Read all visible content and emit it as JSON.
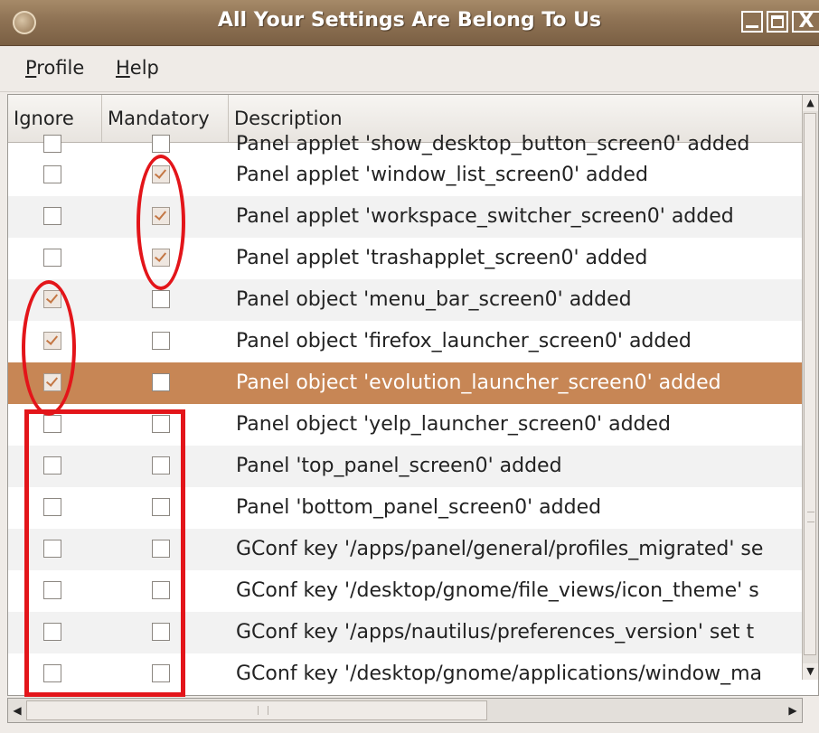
{
  "window": {
    "title": "All Your Settings Are Belong To Us",
    "close_glyph": "X"
  },
  "menubar": {
    "items": [
      {
        "label": "rofile",
        "mnemonic": "P"
      },
      {
        "label": "elp",
        "mnemonic": "H"
      }
    ]
  },
  "table": {
    "columns": [
      "Ignore",
      "Mandatory",
      "Description"
    ],
    "partial_row_text": "Panel applet 'show_desktop_button_screen0' added",
    "rows": [
      {
        "ignore": false,
        "mandatory": true,
        "description": "Panel applet 'window_list_screen0' added"
      },
      {
        "ignore": false,
        "mandatory": true,
        "description": "Panel applet 'workspace_switcher_screen0' added"
      },
      {
        "ignore": false,
        "mandatory": true,
        "description": "Panel applet 'trashapplet_screen0' added"
      },
      {
        "ignore": true,
        "mandatory": false,
        "description": "Panel object 'menu_bar_screen0' added"
      },
      {
        "ignore": true,
        "mandatory": false,
        "description": "Panel object 'firefox_launcher_screen0' added"
      },
      {
        "ignore": true,
        "mandatory": false,
        "description": "Panel object 'evolution_launcher_screen0' added",
        "selected": true
      },
      {
        "ignore": false,
        "mandatory": false,
        "description": "Panel object 'yelp_launcher_screen0' added"
      },
      {
        "ignore": false,
        "mandatory": false,
        "description": "Panel 'top_panel_screen0' added"
      },
      {
        "ignore": false,
        "mandatory": false,
        "description": "Panel 'bottom_panel_screen0' added"
      },
      {
        "ignore": false,
        "mandatory": false,
        "description": "GConf key '/apps/panel/general/profiles_migrated' se"
      },
      {
        "ignore": false,
        "mandatory": false,
        "description": "GConf key '/desktop/gnome/file_views/icon_theme' s"
      },
      {
        "ignore": false,
        "mandatory": false,
        "description": "GConf key '/apps/nautilus/preferences_version' set t"
      },
      {
        "ignore": false,
        "mandatory": false,
        "description": "GConf key '/desktop/gnome/applications/window_ma"
      }
    ]
  },
  "colors": {
    "selection": "#c78655",
    "annotation": "#e3151a",
    "titlebar": "#8e7254"
  },
  "icons": {
    "scroll_up": "▲",
    "scroll_down": "▼",
    "scroll_left": "◀",
    "scroll_right": "▶"
  }
}
